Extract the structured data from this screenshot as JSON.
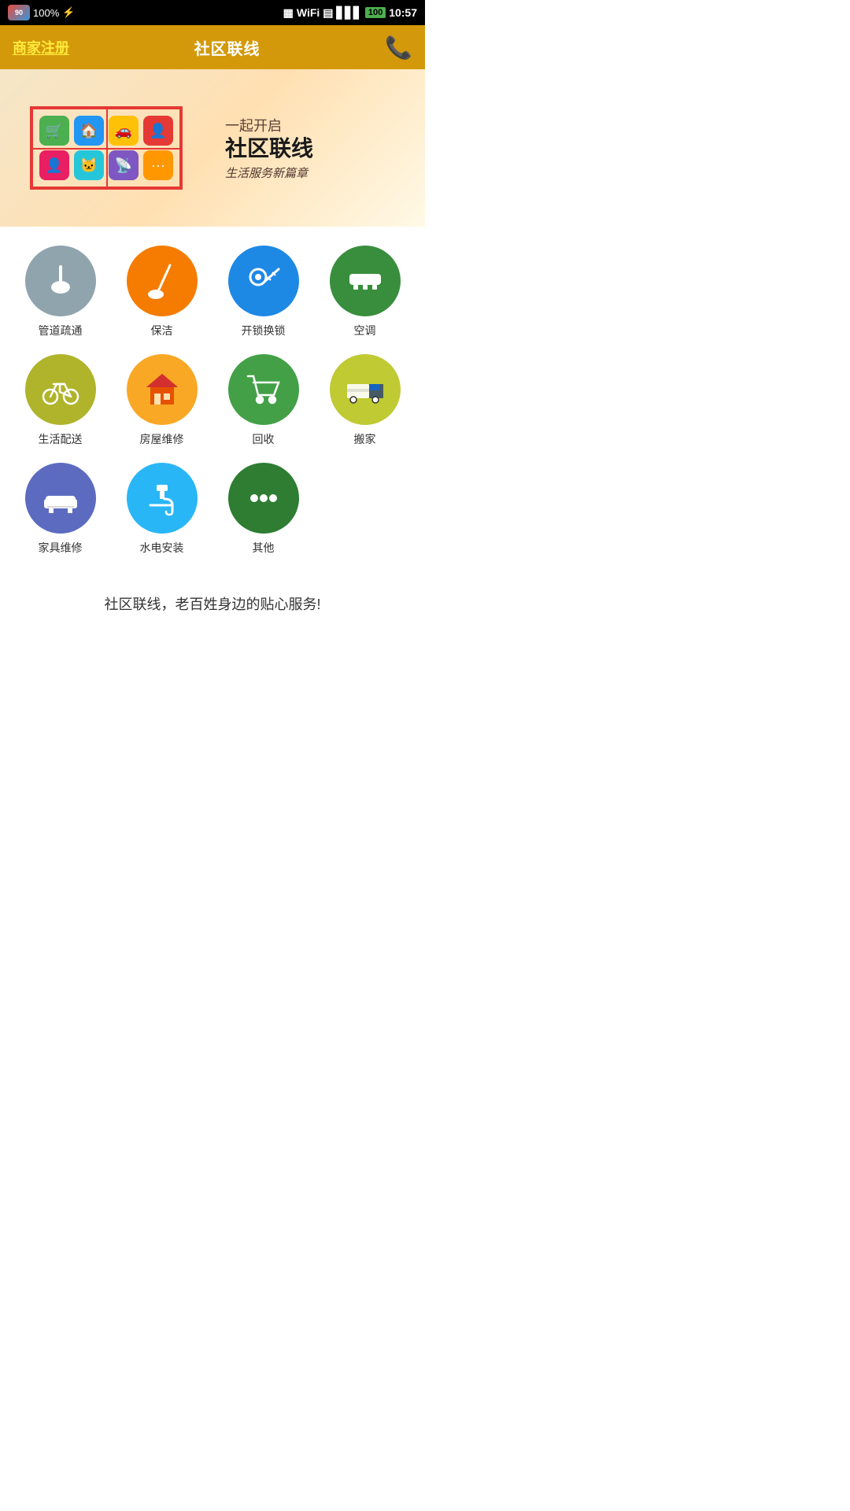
{
  "statusBar": {
    "battery": "100",
    "time": "10:57",
    "logo": "90"
  },
  "header": {
    "leftLabel": "商家注册",
    "title": "社区联线",
    "phoneIcon": "📞"
  },
  "banner": {
    "line1": "一起开启",
    "line2": "社区联线",
    "line3": "生活服务新篇章"
  },
  "services": [
    {
      "id": "pipeline",
      "label": "管道疏通",
      "color": "sc-gray-blue",
      "iconType": "plunger"
    },
    {
      "id": "cleaning",
      "label": "保洁",
      "color": "sc-orange",
      "iconType": "broom"
    },
    {
      "id": "locksmith",
      "label": "开锁换锁",
      "color": "sc-blue",
      "iconType": "key"
    },
    {
      "id": "ac",
      "label": "空调",
      "color": "sc-green-dk",
      "iconType": "ac"
    },
    {
      "id": "delivery",
      "label": "生活配送",
      "color": "sc-olive",
      "iconType": "bicycle"
    },
    {
      "id": "repair",
      "label": "房屋维修",
      "color": "sc-yellow",
      "iconType": "house"
    },
    {
      "id": "recycle",
      "label": "回收",
      "color": "sc-green-mid",
      "iconType": "cart"
    },
    {
      "id": "moving",
      "label": "搬家",
      "color": "sc-lime",
      "iconType": "truck"
    },
    {
      "id": "furniture",
      "label": "家具维修",
      "color": "sc-indigo",
      "iconType": "sofa"
    },
    {
      "id": "plumbing",
      "label": "水电安装",
      "color": "sc-cyan",
      "iconType": "faucet"
    },
    {
      "id": "other",
      "label": "其他",
      "color": "sc-green-br",
      "iconType": "dots"
    }
  ],
  "footerText": "社区联线，老百姓身边的贴心服务!"
}
